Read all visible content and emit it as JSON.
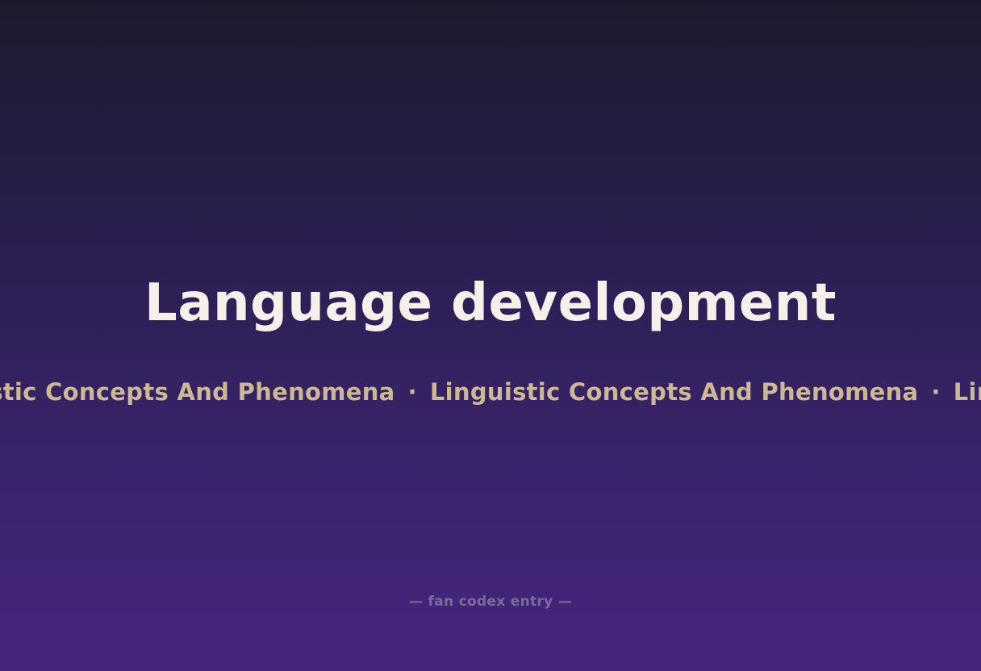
{
  "title": "Language development",
  "ticker": {
    "text": "Linguistic Concepts And Phenomena",
    "separator": "·"
  },
  "footer": {
    "text": "— fan codex entry —"
  },
  "colors": {
    "title": "#f6efea",
    "ticker": "#cdb896",
    "footer": "#7a6c9a",
    "background_top": "#1c1b2e",
    "background_bottom": "#46257f"
  }
}
